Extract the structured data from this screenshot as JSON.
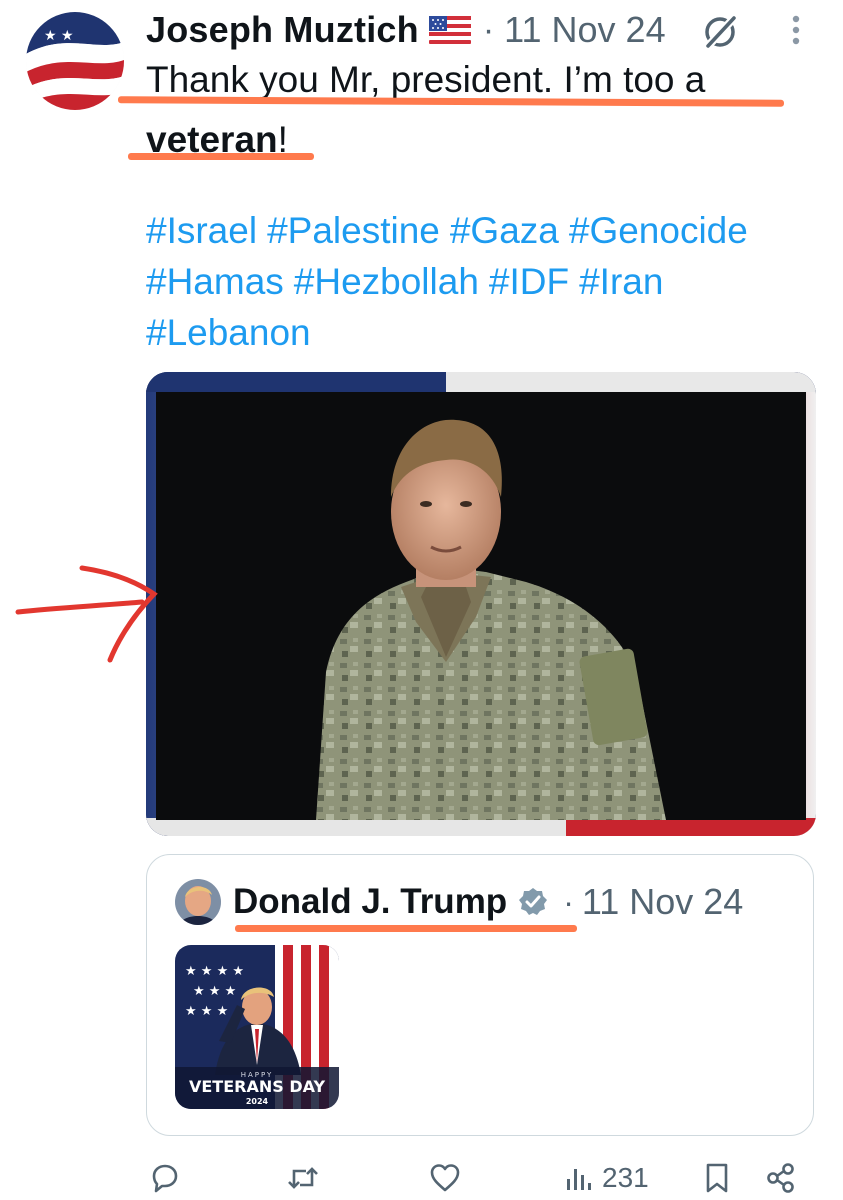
{
  "post": {
    "author_name": "Joseph Muztich",
    "separator": "·",
    "date": "11 Nov 24",
    "text_line1": "Thank you Mr, president. I’m too a",
    "text_bold": "veteran",
    "text_end": "!",
    "hashtags": [
      "#Israel",
      "#Palestine",
      "#Gaza",
      "#Genocide",
      "#Hamas",
      "#Hezbollah",
      "#IDF",
      "#Iran",
      "#Lebanon"
    ]
  },
  "quote": {
    "author_name": "Donald J. Trump",
    "separator": "·",
    "date": "11 Nov 24",
    "media_text_top": "HAPPY",
    "media_text_main": "VETERANS DAY",
    "media_text_year": "2024"
  },
  "actions": {
    "reply_icon": "reply-icon",
    "repost_icon": "repost-icon",
    "like_icon": "heart-icon",
    "views_icon": "views-icon",
    "views_count": "231",
    "bookmark_icon": "bookmark-icon",
    "share_icon": "share-icon"
  },
  "colors": {
    "accent": "#1d9bf0",
    "text": "#0f1419",
    "muted": "#536471",
    "highlight_underline": "#ff7a4d",
    "annotation_arrow": "#e2372f"
  }
}
